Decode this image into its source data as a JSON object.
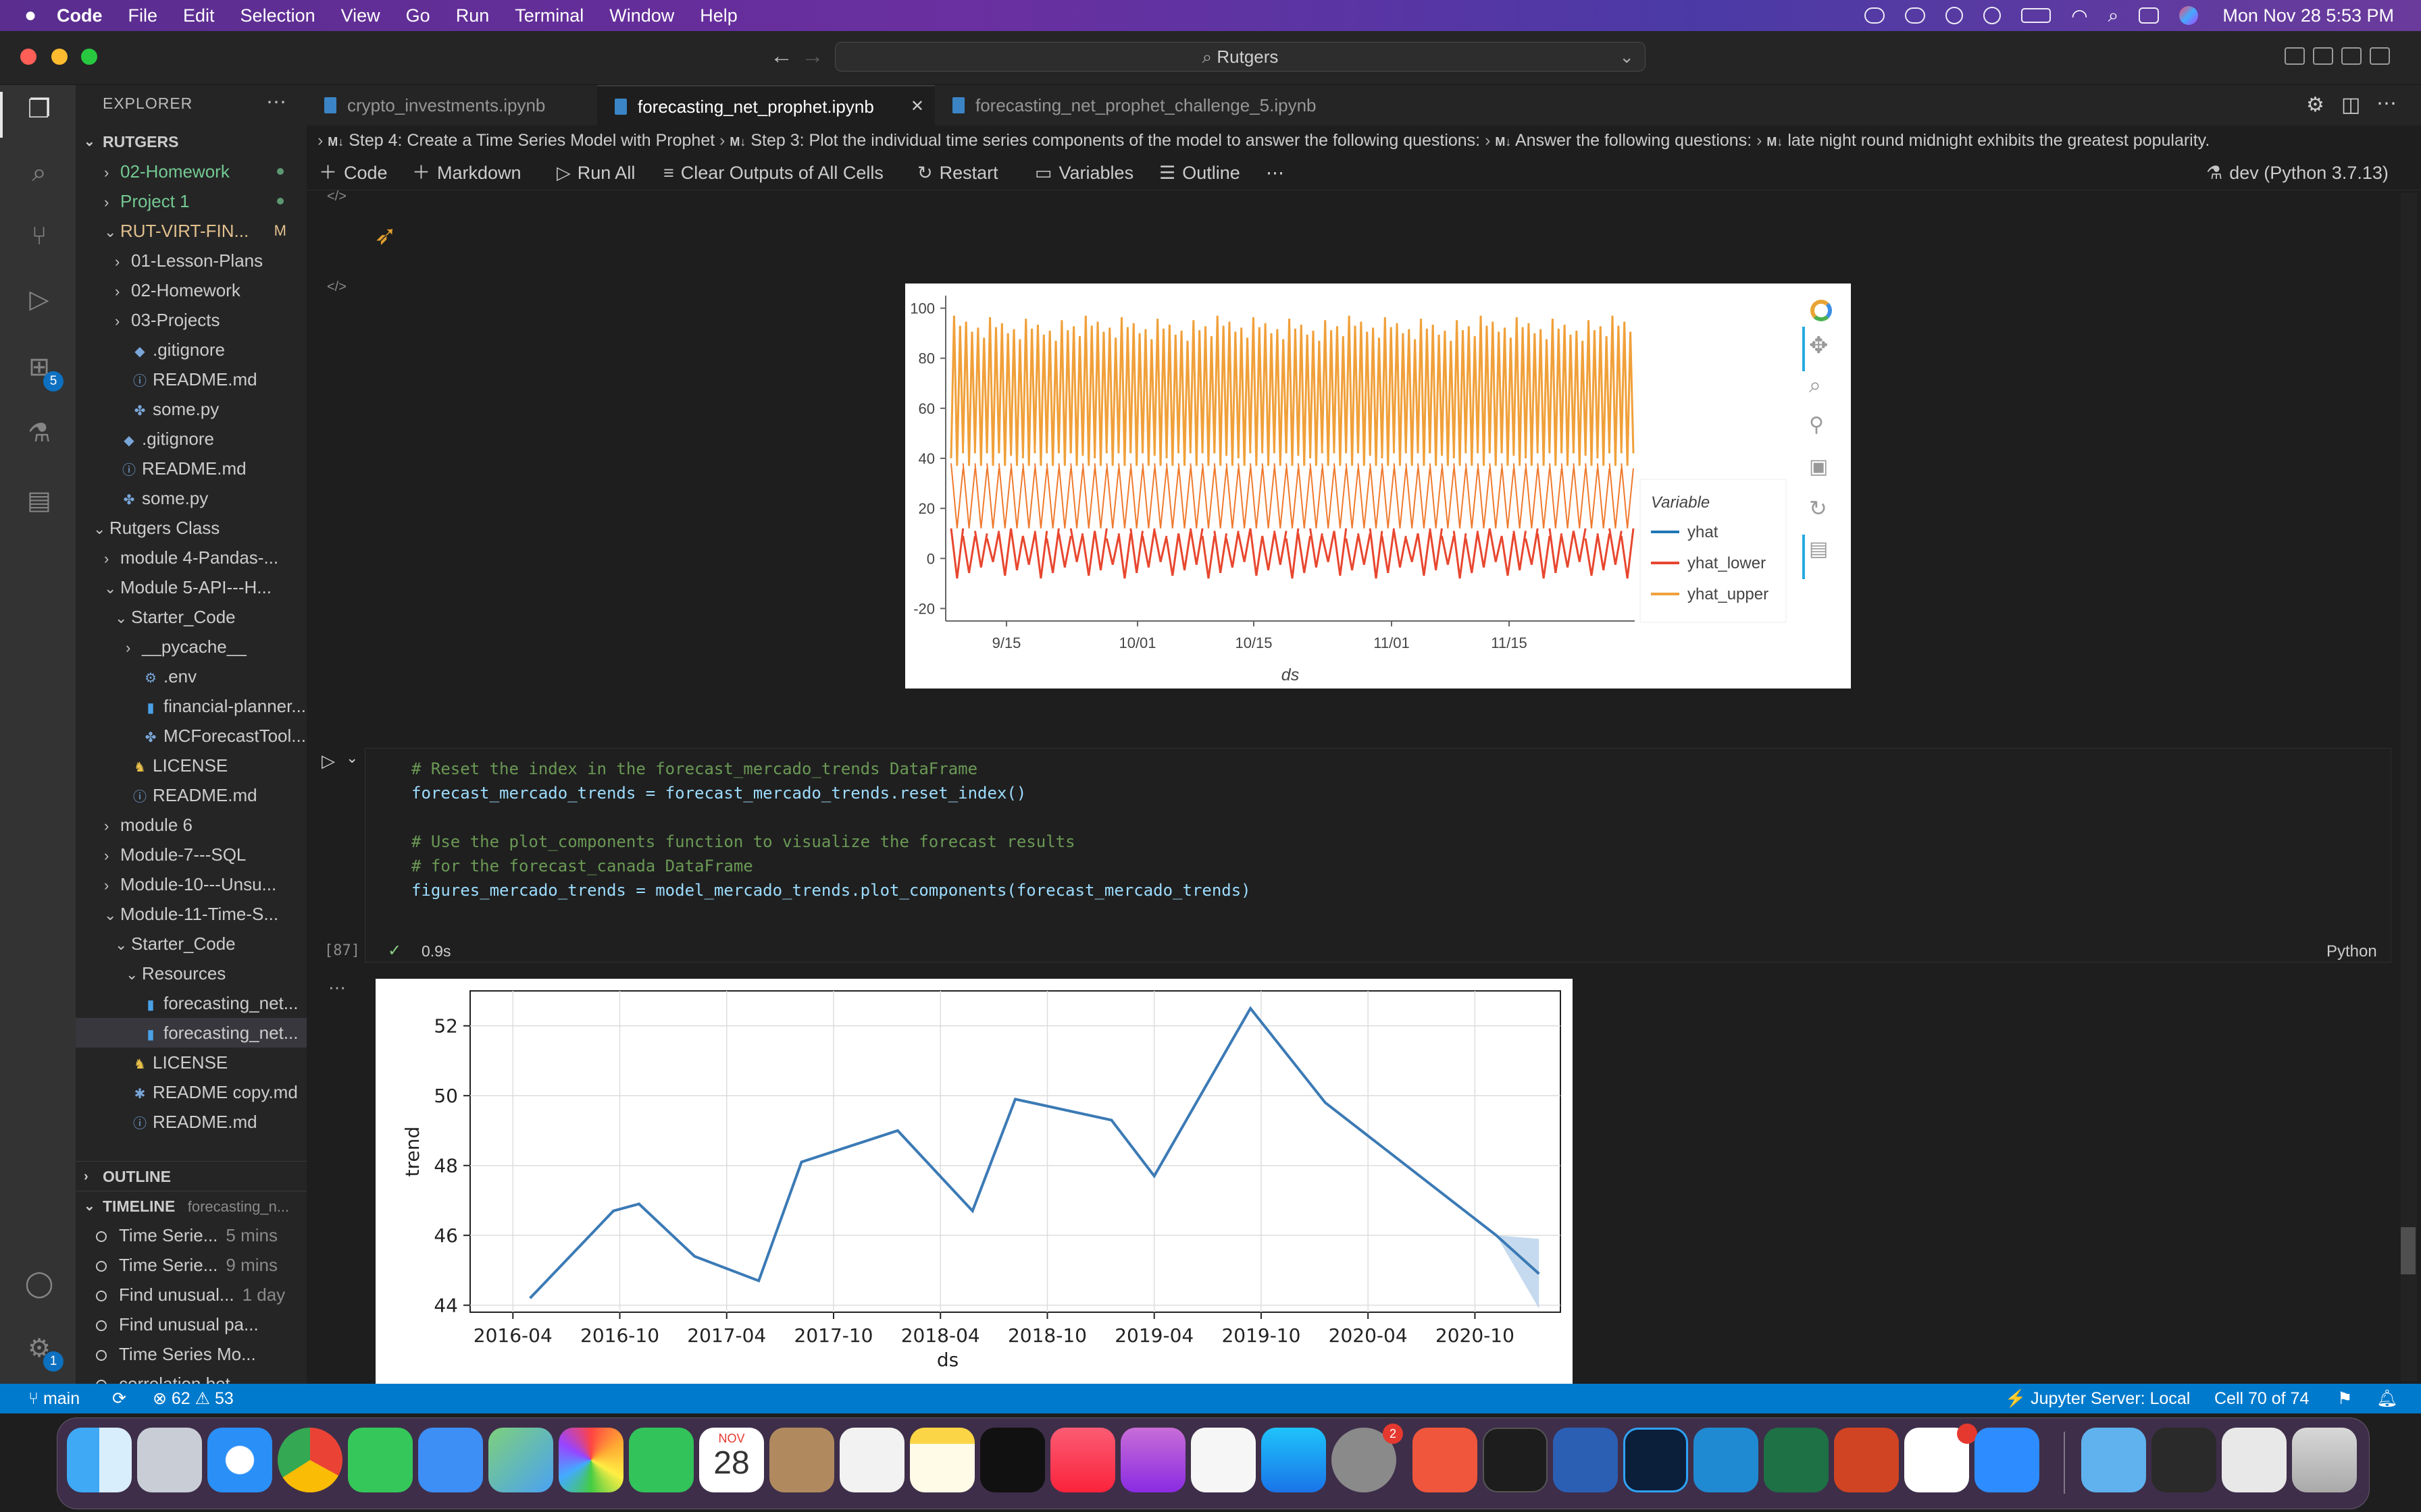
{
  "menubar": {
    "items": [
      "Code",
      "File",
      "Edit",
      "Selection",
      "View",
      "Go",
      "Run",
      "Terminal",
      "Window",
      "Help"
    ],
    "clock": "Mon Nov 28  5:53 PM"
  },
  "titlebar": {
    "search": "Rutgers"
  },
  "activity": {
    "extensions_badge": "5",
    "settings_badge": "1"
  },
  "sidebar": {
    "title": "EXPLORER",
    "root": "RUTGERS",
    "tree": [
      {
        "label": "02-Homework",
        "indent": 1,
        "twisty": ">",
        "icon": "",
        "color": "#73c991",
        "dot": true
      },
      {
        "label": "Project 1",
        "indent": 1,
        "twisty": ">",
        "icon": "",
        "color": "#73c991",
        "dot": true
      },
      {
        "label": "RUT-VIRT-FIN...",
        "indent": 1,
        "twisty": "v",
        "icon": "",
        "color": "#e2c08d",
        "git": "M"
      },
      {
        "label": "01-Lesson-Plans",
        "indent": 2,
        "twisty": ">",
        "icon": ""
      },
      {
        "label": "02-Homework",
        "indent": 2,
        "twisty": ">",
        "icon": ""
      },
      {
        "label": "03-Projects",
        "indent": 2,
        "twisty": ">",
        "icon": ""
      },
      {
        "label": ".gitignore",
        "indent": 2,
        "twisty": "",
        "icon": "◆"
      },
      {
        "label": "README.md",
        "indent": 2,
        "twisty": "",
        "icon": "ⓘ"
      },
      {
        "label": "some.py",
        "indent": 2,
        "twisty": "",
        "icon": "✤"
      },
      {
        "label": ".gitignore",
        "indent": 1,
        "twisty": "",
        "icon": "◆"
      },
      {
        "label": "README.md",
        "indent": 1,
        "twisty": "",
        "icon": "ⓘ"
      },
      {
        "label": "some.py",
        "indent": 1,
        "twisty": "",
        "icon": "✤"
      },
      {
        "label": "Rutgers Class",
        "indent": 0,
        "twisty": "v",
        "icon": ""
      },
      {
        "label": "module 4-Pandas-...",
        "indent": 1,
        "twisty": ">",
        "icon": ""
      },
      {
        "label": "Module 5-API---H...",
        "indent": 1,
        "twisty": "v",
        "icon": ""
      },
      {
        "label": "Starter_Code",
        "indent": 2,
        "twisty": "v",
        "icon": ""
      },
      {
        "label": "__pycache__",
        "indent": 3,
        "twisty": ">",
        "icon": ""
      },
      {
        "label": ".env",
        "indent": 3,
        "twisty": "",
        "icon": "⚙"
      },
      {
        "label": "financial-planner...",
        "indent": 3,
        "twisty": "",
        "icon": "▮"
      },
      {
        "label": "MCForecastTool...",
        "indent": 3,
        "twisty": "",
        "icon": "✤"
      },
      {
        "label": "LICENSE",
        "indent": 2,
        "twisty": "",
        "icon": "♞"
      },
      {
        "label": "README.md",
        "indent": 2,
        "twisty": "",
        "icon": "ⓘ"
      },
      {
        "label": "module 6",
        "indent": 1,
        "twisty": ">",
        "icon": ""
      },
      {
        "label": "Module-7---SQL",
        "indent": 1,
        "twisty": ">",
        "icon": ""
      },
      {
        "label": "Module-10---Unsu...",
        "indent": 1,
        "twisty": ">",
        "icon": ""
      },
      {
        "label": "Module-11-Time-S...",
        "indent": 1,
        "twisty": "v",
        "icon": ""
      },
      {
        "label": "Starter_Code",
        "indent": 2,
        "twisty": "v",
        "icon": ""
      },
      {
        "label": "Resources",
        "indent": 3,
        "twisty": "v",
        "icon": ""
      },
      {
        "label": "forecasting_net...",
        "indent": 3,
        "twisty": "",
        "icon": "▮"
      },
      {
        "label": "forecasting_net...",
        "indent": 3,
        "twisty": "",
        "icon": "▮",
        "selected": true
      },
      {
        "label": "LICENSE",
        "indent": 2,
        "twisty": "",
        "icon": "♞"
      },
      {
        "label": "README copy.md",
        "indent": 2,
        "twisty": "",
        "icon": "✱"
      },
      {
        "label": "README.md",
        "indent": 2,
        "twisty": "",
        "icon": "ⓘ"
      }
    ],
    "outline": "OUTLINE",
    "timeline": "TIMELINE",
    "timeline_file": "forecasting_n...",
    "timeline_items": [
      {
        "label": "Time Serie...",
        "ago": "5 mins"
      },
      {
        "label": "Time Serie...",
        "ago": "9 mins"
      },
      {
        "label": "Find unusual...",
        "ago": "1 day"
      },
      {
        "label": "Find unusual pa...",
        "ago": ""
      },
      {
        "label": "Time Series Mo...",
        "ago": ""
      },
      {
        "label": "correlation bet...",
        "ago": ""
      }
    ]
  },
  "tabs": [
    {
      "label": "crypto_investments.ipynb",
      "active": false
    },
    {
      "label": "forecasting_net_prophet.ipynb",
      "active": true
    },
    {
      "label": "forecasting_net_prophet_challenge_5.ipynb",
      "active": false
    }
  ],
  "breadcrumb": [
    "Step 4: Create a Time Series Model with Prophet",
    "Step 3: Plot the individual time series components of the model to answer the following questions:",
    "Answer the following questions:",
    "late night round midnight exhibits the greatest popularity."
  ],
  "toolbar": {
    "code": "Code",
    "markdown": "Markdown",
    "run_all": "Run All",
    "clear": "Clear Outputs of All Cells",
    "restart": "Restart",
    "variables": "Variables",
    "outline": "Outline",
    "kernel": "dev (Python 3.7.13)"
  },
  "cell": {
    "exec_count": "[87]",
    "duration": "0.9s",
    "language": "Python",
    "lines": [
      {
        "type": "comment",
        "text": "# Reset the index in the forecast_mercado_trends DataFrame"
      },
      {
        "type": "code",
        "text": "forecast_mercado_trends = forecast_mercado_trends.reset_index()"
      },
      {
        "type": "blank",
        "text": ""
      },
      {
        "type": "comment",
        "text": "# Use the plot_components function to visualize the forecast results"
      },
      {
        "type": "comment",
        "text": "# for the forecast_canada DataFrame"
      },
      {
        "type": "code",
        "text": "figures_mercado_trends = model_mercado_trends.plot_components(forecast_mercado_trends)"
      }
    ]
  },
  "chart_data": [
    {
      "type": "line",
      "xlabel": "ds",
      "ylabel": "",
      "ylim": [
        -25,
        105
      ],
      "yticks": [
        -20,
        0,
        20,
        40,
        60,
        80,
        100
      ],
      "xtick_labels": [
        "9/15",
        "10/01",
        "10/15",
        "11/01",
        "11/15"
      ],
      "legend_title": "Variable",
      "legend_position": "right",
      "series": [
        {
          "name": "yhat",
          "color": "#1f77b4"
        },
        {
          "name": "yhat_lower",
          "color": "#e8472f",
          "cycle_min": -8,
          "cycle_max": 12
        },
        {
          "name": "yhat_upper",
          "color": "#f0a03a",
          "cycle_min": 40,
          "cycle_max": 97
        }
      ],
      "cycles": 57
    },
    {
      "type": "line",
      "xlabel": "ds",
      "ylabel": "trend",
      "ylim": [
        43.8,
        53
      ],
      "yticks": [
        44,
        46,
        48,
        50,
        52
      ],
      "xtick_labels": [
        "2016-04",
        "2016-10",
        "2017-04",
        "2017-10",
        "2018-04",
        "2018-10",
        "2019-04",
        "2019-10",
        "2020-04",
        "2020-10"
      ],
      "x": [
        2016.33,
        2016.72,
        2016.84,
        2017.1,
        2017.4,
        2017.6,
        2018.05,
        2018.4,
        2018.6,
        2019.05,
        2019.25,
        2019.7,
        2020.05,
        2020.85,
        2021.05
      ],
      "values": [
        44.2,
        46.7,
        46.9,
        45.4,
        44.7,
        48.1,
        49.0,
        46.7,
        49.9,
        49.3,
        47.7,
        52.5,
        49.8,
        46.0,
        44.9
      ],
      "band": {
        "x": [
          2020.85,
          2021.05
        ],
        "upper": [
          46.0,
          45.9
        ],
        "lower": [
          46.0,
          43.9
        ]
      },
      "color": "#3b7ab5"
    }
  ],
  "status": {
    "branch": "main",
    "errors": "62",
    "warnings": "53",
    "jupyter": "Jupyter Server: Local",
    "cell": "Cell 70 of 74"
  },
  "dock": {
    "calendar_month": "NOV",
    "calendar_day": "28",
    "settings_badge": "2"
  }
}
